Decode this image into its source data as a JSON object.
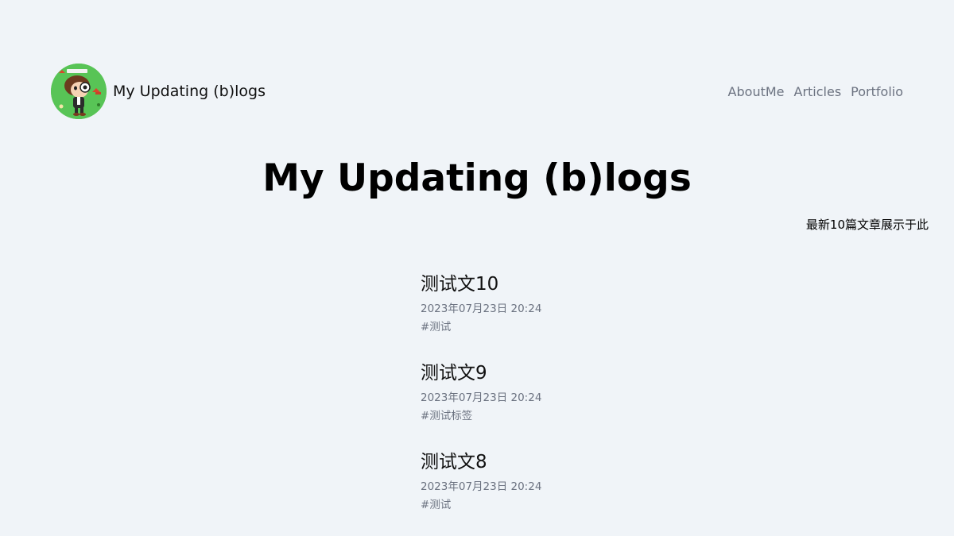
{
  "header": {
    "brand_name": "My Updating (b)logs",
    "nav": [
      "AboutMe",
      "Articles",
      "Portfolio"
    ]
  },
  "main": {
    "title": "My Updating (b)logs",
    "subtitle": "最新10篇文章展示于此",
    "posts": [
      {
        "title": "测试文10",
        "date": "2023年07月23日 20:24",
        "tag": "#测试"
      },
      {
        "title": "测试文9",
        "date": "2023年07月23日 20:24",
        "tag": "#测试标签"
      },
      {
        "title": "测试文8",
        "date": "2023年07月23日 20:24",
        "tag": "#测试"
      }
    ]
  },
  "colors": {
    "background": "#f0f4f8",
    "muted_text": "#6b7280",
    "avatar_bg": "#58c456"
  },
  "icons": {
    "avatar": "cartoon-character-avatar"
  }
}
